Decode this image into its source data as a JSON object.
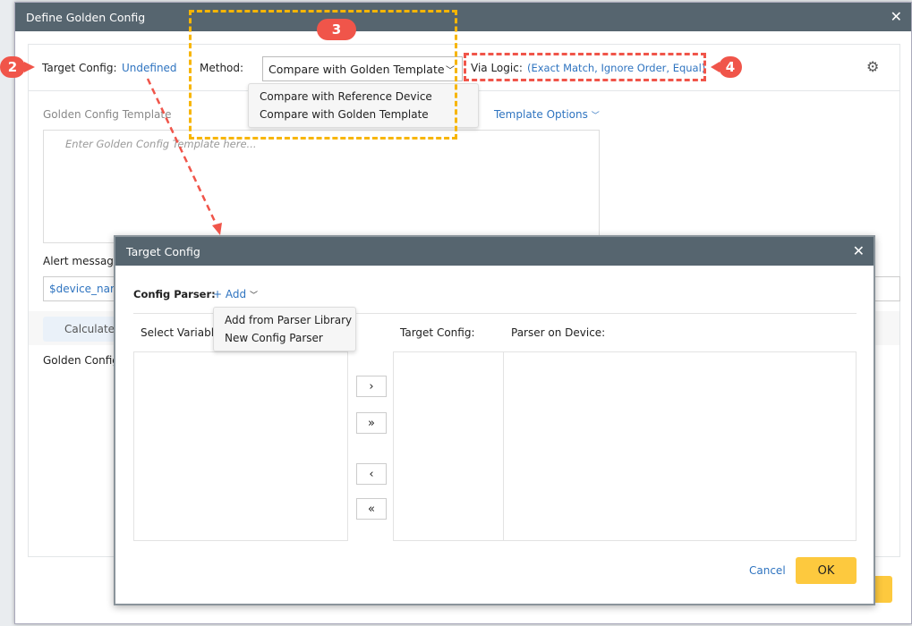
{
  "dialog": {
    "title": "Define Golden Config",
    "close_icon": "close-icon"
  },
  "main": {
    "target_config_label": "Target Config:",
    "target_config_value": "Undefined",
    "method_label": "Method:",
    "method_value": "Compare with Golden Template",
    "method_options": [
      "Compare with Reference Device",
      "Compare with Golden Template"
    ],
    "via_logic_label": "Via Logic:",
    "via_logic_value": "(Exact Match, Ignore Order, Equal)",
    "template_label": "Golden Config Template",
    "template_options": "Template Options",
    "template_placeholder": "Enter Golden Config Template here...",
    "alert_label": "Alert message",
    "alert_value": "$device_nam",
    "calculate_label": "Calculate",
    "golden_config_label": "Golden Config"
  },
  "modal": {
    "title": "Target Config",
    "config_parser_label": "Config Parser:",
    "add_label": "+ Add",
    "add_options": [
      "Add from Parser Library",
      "New Config Parser"
    ],
    "select_variable_label": "Select Variable",
    "target_config_label": "Target Config:",
    "parser_on_device_label": "Parser on Device:",
    "move_buttons": [
      "›",
      "»",
      "‹",
      "«"
    ],
    "cancel_label": "Cancel",
    "ok_label": "OK"
  },
  "annotations": {
    "badge_2": "2",
    "badge_3": "3",
    "badge_4": "4"
  },
  "colors": {
    "header": "#56656f",
    "accent": "#2f74c0",
    "ok": "#fdc93e",
    "annotation_red": "#f0554a",
    "annotation_yellow": "#f7b500"
  }
}
